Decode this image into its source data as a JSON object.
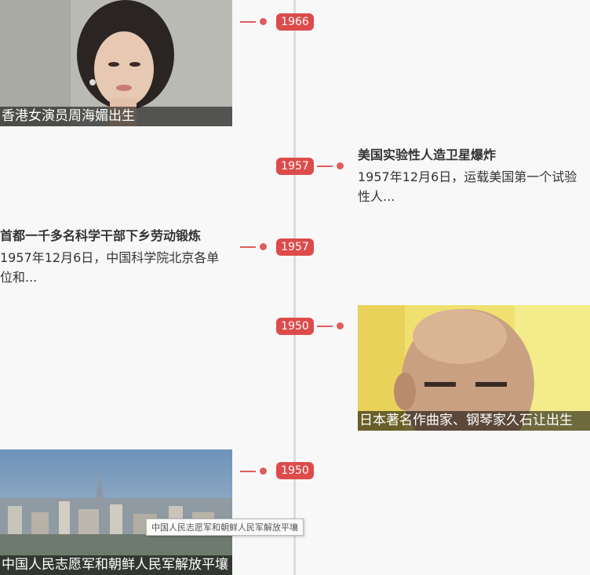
{
  "timeline": {
    "items": [
      {
        "year": "1966",
        "caption": "香港女演员周海媚出生"
      },
      {
        "year": "1957",
        "title": "美国实验性人造卫星爆炸",
        "summary": "1957年12月6日，运载美国第一个试验性人..."
      },
      {
        "year": "1957",
        "title": "首都一千多名科学干部下乡劳动锻炼",
        "summary": "1957年12月6日，中国科学院北京各单位和..."
      },
      {
        "year": "1950",
        "caption": "日本著名作曲家、钢琴家久石让出生"
      },
      {
        "year": "1950",
        "caption": "中国人民志愿军和朝鲜人民军解放平壤"
      }
    ]
  },
  "tooltip": "中国人民志愿军和朝鲜人民军解放平壤",
  "colors": {
    "accent": "#dd4b4b",
    "axis": "#dddddd",
    "background": "#f8f8f8"
  }
}
